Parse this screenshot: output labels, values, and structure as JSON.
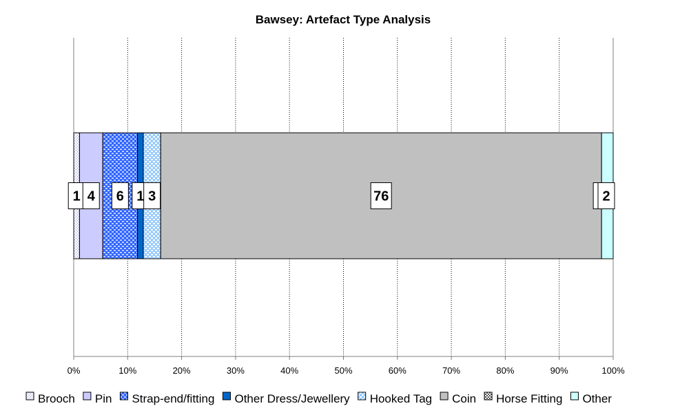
{
  "chart_data": {
    "type": "bar",
    "orientation": "horizontal",
    "stacking": "percent",
    "title": "Bawsey: Artefact Type Analysis",
    "xlabel": "",
    "ylabel": "",
    "xlim": [
      0,
      100
    ],
    "tick_labels": [
      "0%",
      "10%",
      "20%",
      "30%",
      "40%",
      "50%",
      "60%",
      "70%",
      "80%",
      "90%",
      "100%"
    ],
    "grid": true,
    "legend_position": "bottom",
    "categories": [
      ""
    ],
    "series": [
      {
        "name": "Brooch",
        "values": [
          1
        ],
        "color": "#e0e0f8",
        "pattern": "fine-dots"
      },
      {
        "name": "Pin",
        "values": [
          4
        ],
        "color": "#ccccff",
        "pattern": "solid"
      },
      {
        "name": "Strap-end/fitting",
        "values": [
          6
        ],
        "color": "#3366ff",
        "pattern": "checker"
      },
      {
        "name": "Other Dress/Jewellery",
        "values": [
          1
        ],
        "color": "#0066cc",
        "pattern": "solid"
      },
      {
        "name": "Hooked Tag",
        "values": [
          3
        ],
        "color": "#99ccff",
        "pattern": "light-checker"
      },
      {
        "name": "Coin",
        "values": [
          76
        ],
        "color": "#c0c0c0",
        "pattern": "solid"
      },
      {
        "name": "Horse Fitting",
        "values": [
          0
        ],
        "color": "#808080",
        "pattern": "dots"
      },
      {
        "name": "Other",
        "values": [
          2
        ],
        "color": "#ccffff",
        "pattern": "solid"
      }
    ],
    "data_labels": [
      "1",
      "4",
      "6",
      "1",
      "3",
      "76",
      "0",
      "2"
    ]
  }
}
